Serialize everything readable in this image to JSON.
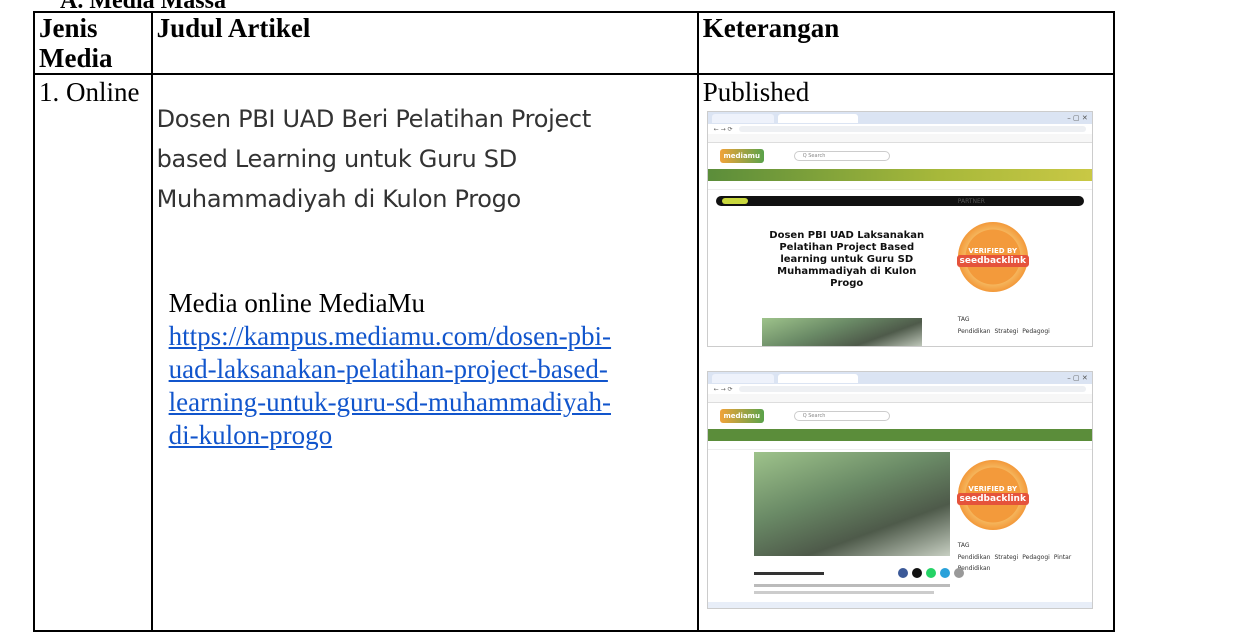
{
  "heading_cut": "A.   Media Massa",
  "table": {
    "headers": {
      "col1": [
        "Jenis",
        "Media"
      ],
      "col2": "Judul Artikel",
      "col3": "Keterangan"
    },
    "row": {
      "jenis": "1. Online",
      "title_lines": [
        "Dosen PBI UAD Beri Pelatihan Project",
        "based Learning untuk Guru SD",
        "Muhammadiyah di Kulon Progo"
      ],
      "media_name": "Media online MediaMu",
      "link_lines": [
        "https://kampus.mediamu.com/dosen-pbi-",
        "uad-laksanakan-pelatihan-project-based-",
        "learning-untuk-guru-sd-muhammadiyah-",
        "di-kulon-progo"
      ],
      "status": "Published"
    }
  },
  "screenshot": {
    "site_logo": "mediamu",
    "search_placeholder": "Q  Search",
    "article_title": "Dosen PBI UAD Laksanakan Pelatihan Project Based learning untuk Guru SD Muhammadiyah di Kulon Progo",
    "partner_label": "PARTNER",
    "badge_top": "VERIFIED BY",
    "badge_brand": "seedbacklink",
    "tag_label": "TAG",
    "tags": [
      "Pendidikan",
      "Strategi",
      "Pedagogi"
    ],
    "tags2": [
      "Pendidikan",
      "Strategi",
      "Pedagogi",
      "Pintar",
      "Pendidikan"
    ]
  }
}
